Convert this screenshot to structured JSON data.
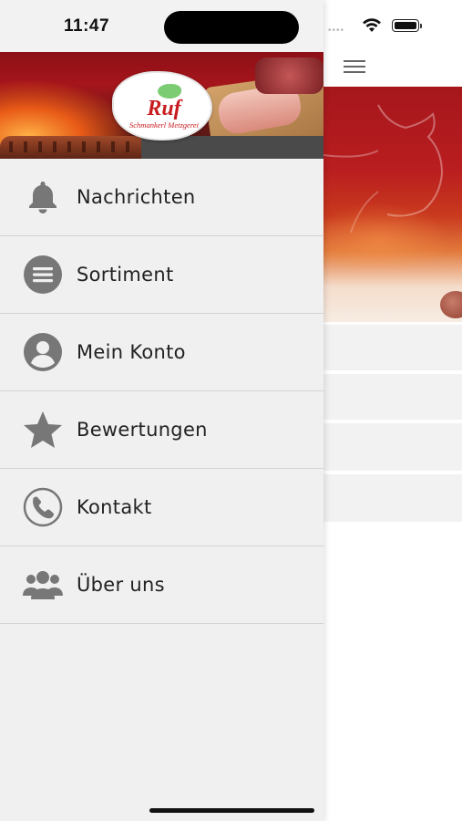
{
  "status_bar": {
    "time": "11:47"
  },
  "brand": {
    "name": "Ruf",
    "tagline": "Schmankerl Metzgerei",
    "color": "#c81c20"
  },
  "menu": {
    "items": [
      {
        "label": "Nachrichten",
        "icon": "bell-icon"
      },
      {
        "label": "Sortiment",
        "icon": "list-icon"
      },
      {
        "label": "Mein Konto",
        "icon": "account-icon"
      },
      {
        "label": "Bewertungen",
        "icon": "star-icon"
      },
      {
        "label": "Kontakt",
        "icon": "phone-icon"
      },
      {
        "label": "Über uns",
        "icon": "group-icon"
      }
    ]
  },
  "colors": {
    "drawer_bg": "#f0f0f0",
    "icon_gray": "#777777",
    "hero_red": "#a5171c"
  }
}
